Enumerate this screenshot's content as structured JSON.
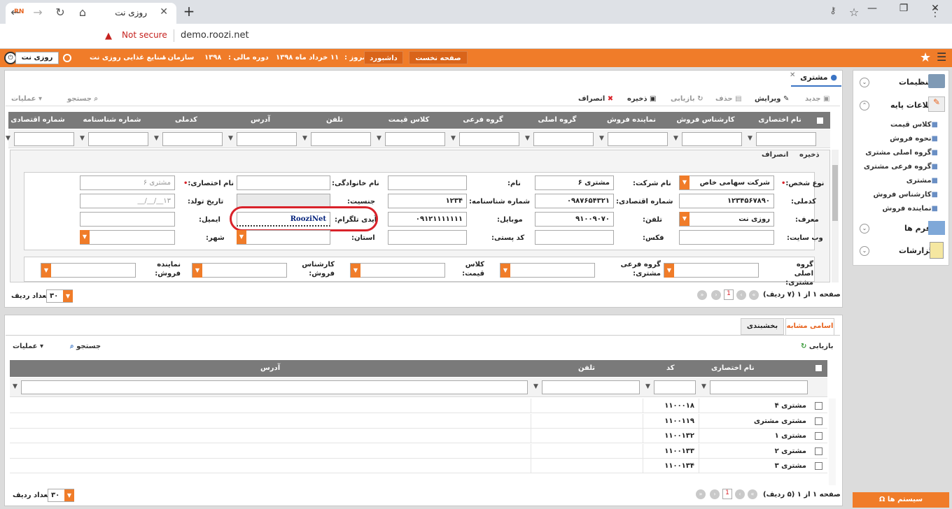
{
  "browser": {
    "tab_title": "روزی نت",
    "tab_icon": "RN",
    "security": "Not secure",
    "url": "demo.roozi.net"
  },
  "header": {
    "company_btn": "روزی نت",
    "org_label": "سازمان :",
    "org_value": "صنایع غذایی روزی نت",
    "fiscal_label": "دوره مالی :",
    "fiscal_value": "۱۳۹۸",
    "today_label": "امروز :",
    "today_value": "۱۱ خرداد ماه ۱۳۹۸",
    "dashboard": "داشبورد",
    "home": "صفحه نخست"
  },
  "page_tab": "مشتری",
  "toolbar": {
    "new": "جدید",
    "edit": "ویرایش",
    "delete": "حذف",
    "refresh": "بازیابی",
    "save": "ذخیره",
    "cancel": "انصراف",
    "search": "جستجو",
    "actions": "عملیات"
  },
  "grid_columns": [
    "نام اختصاری",
    "کارشناس فروش",
    "نماینده فروش",
    "گروه اصلی",
    "گروه فرعی",
    "کلاس قیمت",
    "تلفن",
    "آدرس",
    "کدملی",
    "شماره شناسنامه",
    "شماره اقتصادی"
  ],
  "form": {
    "save": "ذخیره",
    "cancel": "انصراف",
    "person_type_label": "نوع شخص:",
    "person_type_value": "شرکت سهامی خاص",
    "company_name_label": "نام شرکت:",
    "company_name_value": "مشتری ۶",
    "first_name_label": "نام:",
    "last_name_label": "نام خانوادگی:",
    "short_name_label": "نام اختصاری:",
    "short_name_value": "مشتری ۶",
    "national_id_label": "کدملی:",
    "national_id_value": "۱۲۳۴۵۶۷۸۹۰",
    "economic_no_label": "شماره اقتصادی:",
    "economic_no_value": "۰۹۸۷۶۵۴۳۲۱",
    "birth_cert_label": "شماره شناسنامه:",
    "birth_cert_value": "۱۲۳۴",
    "gender_label": "جنسیت:",
    "birth_date_label": "تاریخ تولد:",
    "birth_date_value": "۱۳__/__/__",
    "referrer_label": "معرف:",
    "referrer_value": "روزی نت",
    "phone_label": "تلفن:",
    "phone_value": "۹۱۰۰۹۰۷۰",
    "mobile_label": "موبایل:",
    "mobile_value": "۰۹۱۲۱۱۱۱۱۱۱",
    "telegram_label": "آیدی تلگرام:",
    "telegram_value": "RooziNet",
    "email_label": "ایمیل:",
    "website_label": "وب سایت:",
    "fax_label": "فکس:",
    "postal_label": "کد پستی:",
    "province_label": "استان:",
    "city_label": "شهر:",
    "main_group_label": "گروه اصلی مشتری:",
    "sub_group_label": "گروه فرعی مشتری:",
    "price_class_label": "کلاس قیمت:",
    "sales_expert_label": "کارشناس فروش:",
    "sales_rep_label": "نماینده فروش:"
  },
  "pager1": {
    "text": "صفحه ۱ از ۱ (۷ ردیف)",
    "page": "1",
    "rows_label": "تعداد ردیف",
    "rows_value": "۳۰"
  },
  "bottom": {
    "tab_similar": "اسامی مشابه",
    "tab_segment": "بخشبندی",
    "refresh": "بازیابی",
    "search": "جستجو",
    "actions": "عملیات",
    "columns": {
      "name": "نام اختصاری",
      "code": "کد",
      "phone": "تلفن",
      "address": "آدرس"
    },
    "rows": [
      {
        "name": "مشتری ۴",
        "code": "۱۱۰۰۰۱۸"
      },
      {
        "name": "مشتری مشتری",
        "code": "۱۱۰۰۱۱۹"
      },
      {
        "name": "مشتری ۱",
        "code": "۱۱۰۰۱۳۲"
      },
      {
        "name": "مشتری ۲",
        "code": "۱۱۰۰۱۳۳"
      },
      {
        "name": "مشتری ۳",
        "code": "۱۱۰۰۱۳۴"
      }
    ]
  },
  "pager2": {
    "text": "صفحه ۱ از ۱ (۵ ردیف)",
    "page": "1",
    "rows_label": "تعداد ردیف",
    "rows_value": "۳۰"
  },
  "sidebar": {
    "settings": "تنظیمات",
    "base_info": "اطلاعات پایه",
    "items": [
      "کلاس قیمت",
      "نحوه فروش",
      "گروه اصلی مشتری",
      "گروه فرعی مشتری",
      "مشتری",
      "کارشناس فروش",
      "نماینده فروش"
    ],
    "forms": "فرم ها",
    "reports": "گزارشات",
    "system": "سیستم ها"
  },
  "colors": {
    "accent": "#f07c29",
    "grid_header": "#7a7a7a",
    "highlight": "#d9222a"
  }
}
